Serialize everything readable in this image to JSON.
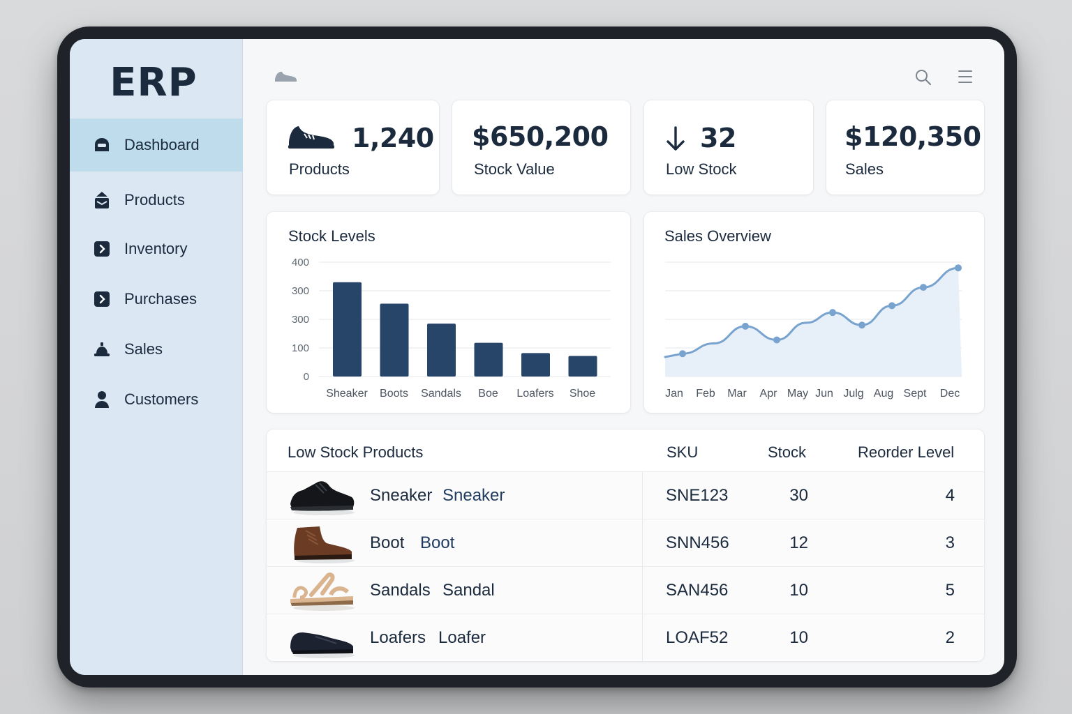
{
  "app": {
    "logo": "ERP"
  },
  "sidebar": {
    "items": [
      {
        "label": "Dashboard",
        "icon": "dashboard-icon",
        "active": true
      },
      {
        "label": "Products",
        "icon": "box-icon"
      },
      {
        "label": "Inventory",
        "icon": "chevron-right-icon"
      },
      {
        "label": "Purchases",
        "icon": "chevron-right-icon"
      },
      {
        "label": "Sales",
        "icon": "bell-icon"
      },
      {
        "label": "Customers",
        "icon": "user-icon"
      }
    ]
  },
  "topbar": {
    "icons": [
      "shoe-icon",
      "search-icon",
      "menu-icon"
    ]
  },
  "kpis": [
    {
      "value": "1,240",
      "label": "Products",
      "icon": "sneaker-icon"
    },
    {
      "value": "$650,200",
      "label": "Stock Value"
    },
    {
      "value": "32",
      "label": "Low Stock",
      "icon": "arrow-down-icon"
    },
    {
      "value": "$120,350",
      "label": "Sales"
    }
  ],
  "stock_levels": {
    "title": "Stock Levels"
  },
  "sales_overview": {
    "title": "Sales Overview"
  },
  "chart_data": [
    {
      "type": "bar",
      "title": "Stock Levels",
      "categories": [
        "Sheaker",
        "Boots",
        "Sandals",
        "Boe",
        "Loafers",
        "Shoe"
      ],
      "values": [
        330,
        255,
        185,
        118,
        82,
        72
      ],
      "y_tick_labels": [
        "0",
        "100",
        "300",
        "300",
        "400"
      ],
      "ylim": [
        0,
        400
      ],
      "grid": true,
      "color": "#274469"
    },
    {
      "type": "area",
      "title": "Sales Overview",
      "categories": [
        "Jan",
        "Feb",
        "Mar",
        "Apr",
        "May",
        "Jun",
        "Julg",
        "Aug",
        "Sept",
        "Dec"
      ],
      "values": [
        20,
        29,
        44,
        32,
        47,
        56,
        45,
        62,
        78,
        95
      ],
      "ylim": [
        0,
        100
      ],
      "grid": true,
      "color": "#79a3cf",
      "fill": "#e7f0f9"
    }
  ],
  "low_stock": {
    "title": "Low Stock Products",
    "columns": [
      "SKU",
      "Stock",
      "Reorder Level"
    ],
    "rows": [
      {
        "name": "Sneaker",
        "variant": "Sneaker",
        "sku": "SNE123",
        "stock": "30",
        "reorder": "4",
        "image": "black-sneaker"
      },
      {
        "name": "Boot",
        "variant": "Boot",
        "sku": "SNN456",
        "stock": "12",
        "reorder": "3",
        "image": "brown-boot"
      },
      {
        "name": "Sandals",
        "variant": "Sandal",
        "sku": "SAN456",
        "stock": "10",
        "reorder": "5",
        "image": "tan-sandal"
      },
      {
        "name": "Loafers",
        "variant": "Loafer",
        "sku": "LOAF52",
        "stock": "10",
        "reorder": "2",
        "image": "black-loafer"
      }
    ]
  },
  "colors": {
    "sidebar": "#dbe8f3",
    "active": "#bfdcec",
    "navy": "#1b2a3d",
    "bar": "#274469",
    "line": "#79a3cf"
  }
}
